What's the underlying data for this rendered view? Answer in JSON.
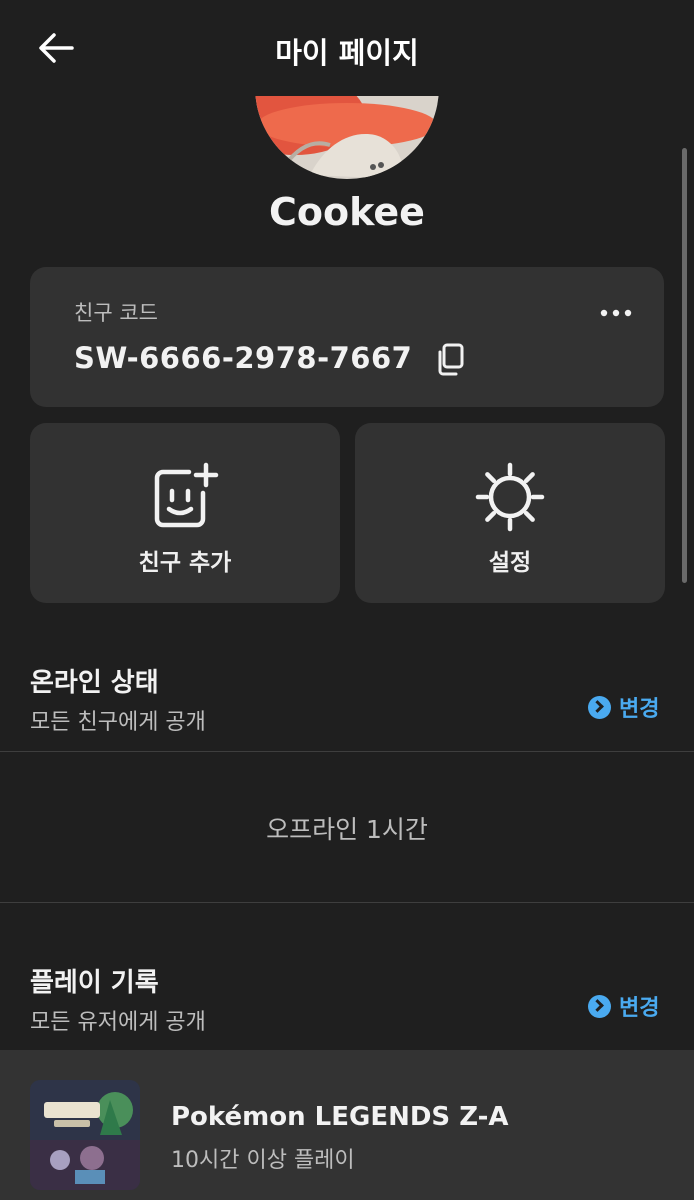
{
  "header": {
    "title": "마이 페이지"
  },
  "profile": {
    "username": "Cookee"
  },
  "friend_code": {
    "label": "친구 코드",
    "value": "SW-6666-2978-7667"
  },
  "actions": {
    "add_friend": "친구 추가",
    "settings": "설정"
  },
  "online_status": {
    "title": "온라인 상태",
    "subtitle": "모든 친구에게 공개",
    "change_label": "변경",
    "status_text": "오프라인 1시간"
  },
  "play_history": {
    "title": "플레이 기록",
    "subtitle": "모든 유저에게 공개",
    "change_label": "변경",
    "games": [
      {
        "title": "Pokémon LEGENDS Z-A",
        "playtime": "10시간 이상 플레이"
      }
    ]
  },
  "colors": {
    "background": "#1f1f1f",
    "card": "#323232",
    "accent": "#4aaaf0"
  }
}
